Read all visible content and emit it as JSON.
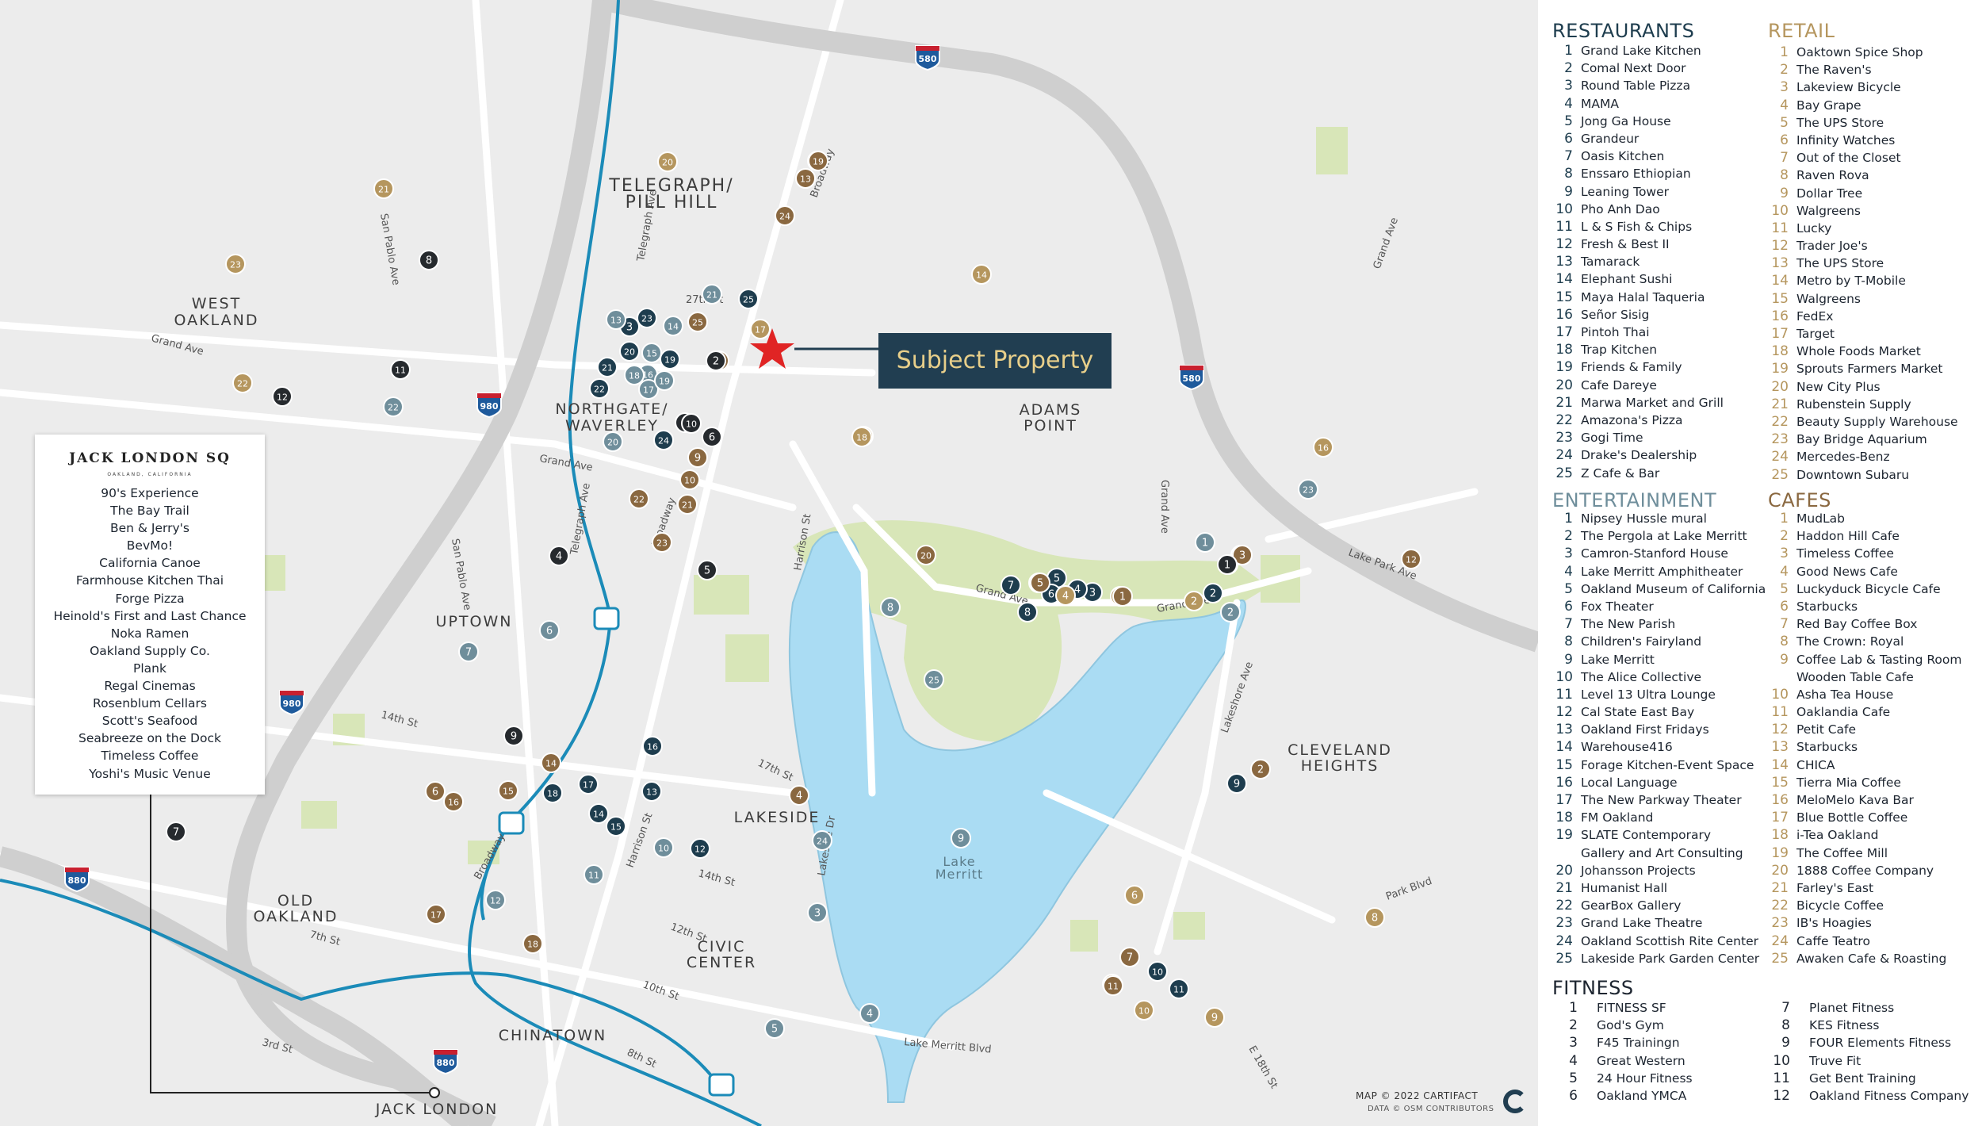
{
  "map": {
    "subject_label": "Subject Property",
    "neighborhoods": [
      "TELEGRAPH/",
      "PILL HILL",
      "WEST",
      "OAKLAND",
      "NORTHGATE/",
      "WAVERLEY",
      "ADAMS",
      "POINT",
      "UPTOWN",
      "LAKESIDE",
      "OLD",
      "OAKLAND",
      "CIVIC",
      "CENTER",
      "CHINATOWN",
      "JACK LONDON",
      "CLEVELAND",
      "HEIGHTS",
      "Lake",
      "Merritt"
    ],
    "streets": [
      "San Pablo Ave",
      "Telegraph Ave",
      "27th St",
      "Broadway",
      "Grand Ave",
      "Grand Ave",
      "San Pablo Ave",
      "Telegraph Ave",
      "Broadway",
      "Harrison St",
      "Grand Ave",
      "Grand Ave",
      "Grand Ave",
      "Lake Park Ave",
      "Grand Ave",
      "Lakeshore Ave",
      "14th St",
      "17th St",
      "Harrison St",
      "14th St",
      "Lakeside Dr",
      "Broadway",
      "12th St",
      "7th St",
      "10th St",
      "3rd St",
      "8th St",
      "Lake Merritt Blvd",
      "Park Blvd",
      "E 18th St"
    ],
    "highway_shields": [
      "580",
      "580",
      "980",
      "980",
      "880",
      "880"
    ],
    "colors": {
      "restaurants": "#1e3d4e",
      "retail": "#b5965e",
      "entertainment": "#6f8e9b",
      "cafes": "#8a6840",
      "fitness": "#262a2e",
      "water": "#aadcf3",
      "park": "#d8e6b8",
      "land": "#ececec",
      "freeway": "#cfcfcf",
      "bart": "#1b8bb8",
      "star": "#e02424"
    },
    "markers": [
      {
        "cat": "restaurants",
        "n": "1"
      },
      {
        "cat": "restaurants",
        "n": "1"
      },
      {
        "cat": "restaurants",
        "n": "2"
      },
      {
        "cat": "restaurants",
        "n": "3"
      },
      {
        "cat": "restaurants",
        "n": "3"
      },
      {
        "cat": "restaurants",
        "n": "4"
      },
      {
        "cat": "restaurants",
        "n": "5"
      },
      {
        "cat": "restaurants",
        "n": "6"
      },
      {
        "cat": "restaurants",
        "n": "7"
      },
      {
        "cat": "restaurants",
        "n": "8"
      },
      {
        "cat": "restaurants",
        "n": "9"
      },
      {
        "cat": "restaurants",
        "n": "10"
      },
      {
        "cat": "restaurants",
        "n": "11"
      },
      {
        "cat": "restaurants",
        "n": "12"
      },
      {
        "cat": "restaurants",
        "n": "13"
      },
      {
        "cat": "restaurants",
        "n": "14"
      },
      {
        "cat": "restaurants",
        "n": "15"
      },
      {
        "cat": "restaurants",
        "n": "16"
      },
      {
        "cat": "restaurants",
        "n": "17"
      },
      {
        "cat": "restaurants",
        "n": "18"
      },
      {
        "cat": "restaurants",
        "n": "19"
      },
      {
        "cat": "restaurants",
        "n": "20"
      },
      {
        "cat": "restaurants",
        "n": "21"
      },
      {
        "cat": "restaurants",
        "n": "22"
      },
      {
        "cat": "restaurants",
        "n": "23"
      },
      {
        "cat": "restaurants",
        "n": "24"
      },
      {
        "cat": "restaurants",
        "n": "25"
      },
      {
        "cat": "retail",
        "n": "1"
      },
      {
        "cat": "retail",
        "n": "2"
      },
      {
        "cat": "retail",
        "n": "3"
      },
      {
        "cat": "retail",
        "n": "4"
      },
      {
        "cat": "retail",
        "n": "5"
      },
      {
        "cat": "retail",
        "n": "6"
      },
      {
        "cat": "retail",
        "n": "7"
      },
      {
        "cat": "retail",
        "n": "8"
      },
      {
        "cat": "retail",
        "n": "9"
      },
      {
        "cat": "retail",
        "n": "10"
      },
      {
        "cat": "retail",
        "n": "11"
      },
      {
        "cat": "retail",
        "n": "12"
      },
      {
        "cat": "retail",
        "n": "13"
      },
      {
        "cat": "retail",
        "n": "14"
      },
      {
        "cat": "retail",
        "n": "15"
      },
      {
        "cat": "retail",
        "n": "16"
      },
      {
        "cat": "retail",
        "n": "17"
      },
      {
        "cat": "retail",
        "n": "18"
      },
      {
        "cat": "retail",
        "n": "19"
      },
      {
        "cat": "retail",
        "n": "20"
      },
      {
        "cat": "retail",
        "n": "21"
      },
      {
        "cat": "retail",
        "n": "22"
      },
      {
        "cat": "retail",
        "n": "23"
      },
      {
        "cat": "retail",
        "n": "24"
      },
      {
        "cat": "retail",
        "n": "25"
      },
      {
        "cat": "entertainment",
        "n": "1"
      },
      {
        "cat": "entertainment",
        "n": "2"
      },
      {
        "cat": "entertainment",
        "n": "3"
      },
      {
        "cat": "entertainment",
        "n": "4"
      },
      {
        "cat": "entertainment",
        "n": "5"
      },
      {
        "cat": "entertainment",
        "n": "6"
      },
      {
        "cat": "entertainment",
        "n": "7"
      },
      {
        "cat": "entertainment",
        "n": "8"
      },
      {
        "cat": "entertainment",
        "n": "9"
      },
      {
        "cat": "entertainment",
        "n": "10"
      },
      {
        "cat": "entertainment",
        "n": "11"
      },
      {
        "cat": "entertainment",
        "n": "12"
      },
      {
        "cat": "entertainment",
        "n": "13"
      },
      {
        "cat": "entertainment",
        "n": "14"
      },
      {
        "cat": "entertainment",
        "n": "15"
      },
      {
        "cat": "entertainment",
        "n": "16"
      },
      {
        "cat": "entertainment",
        "n": "17"
      },
      {
        "cat": "entertainment",
        "n": "18"
      },
      {
        "cat": "entertainment",
        "n": "19"
      },
      {
        "cat": "entertainment",
        "n": "20"
      },
      {
        "cat": "entertainment",
        "n": "21"
      },
      {
        "cat": "entertainment",
        "n": "22"
      },
      {
        "cat": "entertainment",
        "n": "23"
      },
      {
        "cat": "entertainment",
        "n": "24"
      },
      {
        "cat": "entertainment",
        "n": "25"
      },
      {
        "cat": "cafes",
        "n": "1"
      },
      {
        "cat": "cafes",
        "n": "2"
      },
      {
        "cat": "cafes",
        "n": "3"
      },
      {
        "cat": "cafes",
        "n": "4"
      },
      {
        "cat": "cafes",
        "n": "5"
      },
      {
        "cat": "cafes",
        "n": "6"
      },
      {
        "cat": "cafes",
        "n": "7"
      },
      {
        "cat": "cafes",
        "n": "8"
      },
      {
        "cat": "cafes",
        "n": "9"
      },
      {
        "cat": "cafes",
        "n": "10"
      },
      {
        "cat": "cafes",
        "n": "11"
      },
      {
        "cat": "cafes",
        "n": "12"
      },
      {
        "cat": "cafes",
        "n": "13"
      },
      {
        "cat": "cafes",
        "n": "14"
      },
      {
        "cat": "cafes",
        "n": "15"
      },
      {
        "cat": "cafes",
        "n": "16"
      },
      {
        "cat": "cafes",
        "n": "17"
      },
      {
        "cat": "cafes",
        "n": "18"
      },
      {
        "cat": "cafes",
        "n": "19"
      },
      {
        "cat": "cafes",
        "n": "20"
      },
      {
        "cat": "cafes",
        "n": "21"
      },
      {
        "cat": "cafes",
        "n": "22"
      },
      {
        "cat": "cafes",
        "n": "23"
      },
      {
        "cat": "cafes",
        "n": "24"
      },
      {
        "cat": "cafes",
        "n": "25"
      },
      {
        "cat": "fitness",
        "n": "1"
      },
      {
        "cat": "fitness",
        "n": "2"
      },
      {
        "cat": "fitness",
        "n": "3"
      },
      {
        "cat": "fitness",
        "n": "4"
      },
      {
        "cat": "fitness",
        "n": "5"
      },
      {
        "cat": "fitness",
        "n": "6"
      },
      {
        "cat": "fitness",
        "n": "7"
      },
      {
        "cat": "fitness",
        "n": "8"
      },
      {
        "cat": "fitness",
        "n": "9"
      },
      {
        "cat": "fitness",
        "n": "10"
      },
      {
        "cat": "fitness",
        "n": "11"
      },
      {
        "cat": "fitness",
        "n": "12"
      }
    ]
  },
  "jack_london_box": {
    "logo": "JACK LONDON SQ",
    "logo_sub": "OAKLAND, CALIFORNIA",
    "items": [
      "90's Experience",
      "The Bay Trail",
      "Ben & Jerry's",
      "BevMo!",
      "California Canoe",
      "Farmhouse Kitchen Thai",
      "Forge Pizza",
      "Heinold's First and Last Chance",
      "Noka Ramen",
      "Oakland Supply Co.",
      "Plank",
      "Regal Cinemas",
      "Rosenblum Cellars",
      "Scott's Seafood",
      "Seabreeze on the Dock",
      "Timeless Coffee",
      "Yoshi's Music Venue"
    ]
  },
  "legend": {
    "restaurants": {
      "title": "RESTAURANTS",
      "items": [
        {
          "n": "1",
          "name": "Grand Lake Kitchen"
        },
        {
          "n": "2",
          "name": "Comal Next Door"
        },
        {
          "n": "3",
          "name": "Round Table Pizza"
        },
        {
          "n": "4",
          "name": "MAMA"
        },
        {
          "n": "5",
          "name": "Jong Ga House"
        },
        {
          "n": "6",
          "name": "Grandeur"
        },
        {
          "n": "7",
          "name": "Oasis Kitchen"
        },
        {
          "n": "8",
          "name": "Enssaro Ethiopian"
        },
        {
          "n": "9",
          "name": "Leaning Tower"
        },
        {
          "n": "10",
          "name": "Pho Anh Dao"
        },
        {
          "n": "11",
          "name": "L & S Fish & Chips"
        },
        {
          "n": "12",
          "name": "Fresh & Best II"
        },
        {
          "n": "13",
          "name": "Tamarack"
        },
        {
          "n": "14",
          "name": "Elephant Sushi"
        },
        {
          "n": "15",
          "name": "Maya Halal Taqueria"
        },
        {
          "n": "16",
          "name": "Señor Sisig"
        },
        {
          "n": "17",
          "name": "Pintoh Thai"
        },
        {
          "n": "18",
          "name": "Trap Kitchen"
        },
        {
          "n": "19",
          "name": "Friends & Family"
        },
        {
          "n": "20",
          "name": "Cafe Dareye"
        },
        {
          "n": "21",
          "name": "Marwa Market and Grill"
        },
        {
          "n": "22",
          "name": "Amazona's Pizza"
        },
        {
          "n": "23",
          "name": "Gogi Time"
        },
        {
          "n": "24",
          "name": "Drake's Dealership"
        },
        {
          "n": "25",
          "name": "Z Cafe & Bar"
        }
      ]
    },
    "retail": {
      "title": "RETAIL",
      "items": [
        {
          "n": "1",
          "name": "Oaktown Spice Shop"
        },
        {
          "n": "2",
          "name": "The Raven's"
        },
        {
          "n": "3",
          "name": "Lakeview Bicycle"
        },
        {
          "n": "4",
          "name": "Bay Grape"
        },
        {
          "n": "5",
          "name": "The UPS Store"
        },
        {
          "n": "6",
          "name": "Infinity Watches"
        },
        {
          "n": "7",
          "name": "Out of the Closet"
        },
        {
          "n": "8",
          "name": "Raven Rova"
        },
        {
          "n": "9",
          "name": "Dollar Tree"
        },
        {
          "n": "10",
          "name": "Walgreens"
        },
        {
          "n": "11",
          "name": "Lucky"
        },
        {
          "n": "12",
          "name": "Trader Joe's"
        },
        {
          "n": "13",
          "name": "The UPS Store"
        },
        {
          "n": "14",
          "name": "Metro by T-Mobile"
        },
        {
          "n": "15",
          "name": "Walgreens"
        },
        {
          "n": "16",
          "name": "FedEx"
        },
        {
          "n": "17",
          "name": "Target"
        },
        {
          "n": "18",
          "name": "Whole Foods Market"
        },
        {
          "n": "19",
          "name": "Sprouts Farmers Market"
        },
        {
          "n": "20",
          "name": "New City Plus"
        },
        {
          "n": "21",
          "name": "Rubenstein Supply"
        },
        {
          "n": "22",
          "name": "Beauty Supply Warehouse"
        },
        {
          "n": "23",
          "name": "Bay Bridge Aquarium"
        },
        {
          "n": "24",
          "name": "Mercedes-Benz"
        },
        {
          "n": "25",
          "name": "Downtown Subaru"
        }
      ]
    },
    "entertainment": {
      "title": "ENTERTAINMENT",
      "items": [
        {
          "n": "1",
          "name": "Nipsey Hussle mural"
        },
        {
          "n": "2",
          "name": "The Pergola at Lake Merritt"
        },
        {
          "n": "3",
          "name": "Camron-Stanford House"
        },
        {
          "n": "4",
          "name": "Lake Merritt Amphitheater"
        },
        {
          "n": "5",
          "name": "Oakland Museum of California"
        },
        {
          "n": "6",
          "name": "Fox Theater"
        },
        {
          "n": "7",
          "name": "The New Parish"
        },
        {
          "n": "8",
          "name": "Children's Fairyland"
        },
        {
          "n": "9",
          "name": "Lake Merritt"
        },
        {
          "n": "10",
          "name": "The Alice Collective"
        },
        {
          "n": "11",
          "name": "Level 13 Ultra Lounge"
        },
        {
          "n": "12",
          "name": "Cal State East Bay"
        },
        {
          "n": "13",
          "name": "Oakland First Fridays"
        },
        {
          "n": "14",
          "name": "Warehouse416"
        },
        {
          "n": "15",
          "name": "Forage Kitchen-Event Space"
        },
        {
          "n": "16",
          "name": "Local Language"
        },
        {
          "n": "17",
          "name": "The New Parkway Theater"
        },
        {
          "n": "18",
          "name": "FM Oakland"
        },
        {
          "n": "19",
          "name": "SLATE Contemporary"
        },
        {
          "n": "",
          "name": "Gallery and Art Consulting"
        },
        {
          "n": "20",
          "name": "Johansson Projects"
        },
        {
          "n": "21",
          "name": "Humanist Hall"
        },
        {
          "n": "22",
          "name": "GearBox Gallery"
        },
        {
          "n": "23",
          "name": "Grand Lake Theatre"
        },
        {
          "n": "24",
          "name": "Oakland Scottish Rite Center"
        },
        {
          "n": "25",
          "name": "Lakeside Park Garden Center"
        }
      ]
    },
    "cafes": {
      "title": "CAFES",
      "items": [
        {
          "n": "1",
          "name": "MudLab"
        },
        {
          "n": "2",
          "name": "Haddon Hill Cafe"
        },
        {
          "n": "3",
          "name": "Timeless Coffee"
        },
        {
          "n": "4",
          "name": "Good News Cafe"
        },
        {
          "n": "5",
          "name": "Luckyduck Bicycle Cafe"
        },
        {
          "n": "6",
          "name": "Starbucks"
        },
        {
          "n": "7",
          "name": "Red Bay Coffee Box"
        },
        {
          "n": "8",
          "name": "The Crown: Royal"
        },
        {
          "n": "9",
          "name": "Coffee Lab & Tasting Room"
        },
        {
          "n": "",
          "name": "Wooden Table Cafe"
        },
        {
          "n": "10",
          "name": "Asha Tea House"
        },
        {
          "n": "11",
          "name": "Oaklandia Cafe"
        },
        {
          "n": "12",
          "name": "Petit Cafe"
        },
        {
          "n": "13",
          "name": "Starbucks"
        },
        {
          "n": "14",
          "name": "CHICA"
        },
        {
          "n": "15",
          "name": "Tierra Mia Coffee"
        },
        {
          "n": "16",
          "name": "MeloMelo Kava Bar"
        },
        {
          "n": "17",
          "name": "Blue Bottle Coffee"
        },
        {
          "n": "18",
          "name": "i-Tea Oakland"
        },
        {
          "n": "19",
          "name": "The Coffee Mill"
        },
        {
          "n": "20",
          "name": "1888 Coffee Company"
        },
        {
          "n": "21",
          "name": "Farley's East"
        },
        {
          "n": "22",
          "name": "Bicycle Coffee"
        },
        {
          "n": "23",
          "name": "IB's Hoagies"
        },
        {
          "n": "24",
          "name": "Caffe Teatro"
        },
        {
          "n": "25",
          "name": "Awaken Cafe & Roasting"
        }
      ]
    },
    "fitness": {
      "title": "FITNESS",
      "col1": [
        {
          "n": "1",
          "name": "FITNESS SF"
        },
        {
          "n": "2",
          "name": "God's Gym"
        },
        {
          "n": "3",
          "name": "F45 Trainingn"
        },
        {
          "n": "4",
          "name": "Great Western"
        },
        {
          "n": "5",
          "name": "24 Hour Fitness"
        },
        {
          "n": "6",
          "name": "Oakland YMCA"
        }
      ],
      "col2": [
        {
          "n": "7",
          "name": "Planet Fitness"
        },
        {
          "n": "8",
          "name": "KES Fitness"
        },
        {
          "n": "9",
          "name": "FOUR Elements Fitness"
        },
        {
          "n": "10",
          "name": "Truve Fit"
        },
        {
          "n": "11",
          "name": "Get Bent Training"
        },
        {
          "n": "12",
          "name": "Oakland Fitness Company"
        }
      ]
    },
    "credit1": "MAP © 2022 CARTIFACT",
    "credit2": "DATA © OSM CONTRIBUTORS"
  }
}
